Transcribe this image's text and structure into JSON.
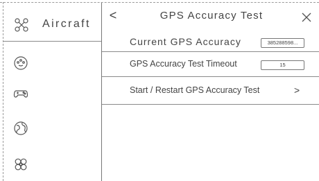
{
  "sidebar": {
    "title": "Aircraft",
    "header_icon": "drone-icon",
    "items": [
      {
        "icon": "gimbal-icon"
      },
      {
        "icon": "gamepad-icon"
      },
      {
        "icon": "globe-icon"
      },
      {
        "icon": "propeller-icon"
      }
    ]
  },
  "panel": {
    "title": "GPS Accuracy Test",
    "back_label": "<",
    "close_icon": "close-icon"
  },
  "rows": [
    {
      "label": "Current GPS Accuracy",
      "value": "385288598..."
    },
    {
      "label": "GPS Accuracy Test Timeout",
      "value": "15"
    },
    {
      "label": "Start / Restart GPS Accuracy Test",
      "chevron": ">"
    }
  ]
}
